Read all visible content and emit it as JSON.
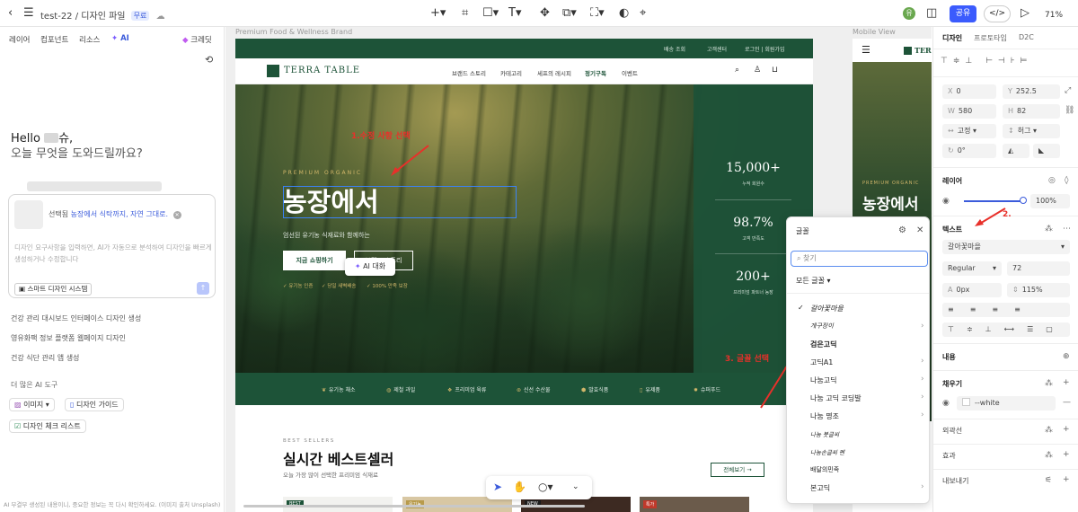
{
  "toolbar": {
    "breadcrumb_project": "test-22",
    "breadcrumb_sep": "/",
    "file_name": "디자인 파일",
    "badge": "무료",
    "share": "공유",
    "zoom": "71%",
    "avatar_initial": "유"
  },
  "left_panel": {
    "tabs": [
      "레이어",
      "컴포넌트",
      "리소스",
      "AI"
    ],
    "credit": "크레딧",
    "greeting_line1_a": "Hello",
    "greeting_line1_b": "슈,",
    "greeting_line2": "오늘 무엇을 도와드릴까요?",
    "selection_label": "선택됨",
    "selection_value": "농장에서 식탁까지, 자연 그대로.",
    "input_placeholder": "디자인 요구사항을 입력하면, AI가 자동으로 분석하여 디자인을 빠르게 생성하거나 수정합니다",
    "smart_design": "스마트 디자인 시스템",
    "suggestions": [
      "건강 관리 대시보드 인터페이스 디자인 생성",
      "영유화팩 정보 플랫폼 웹페이지 디자인",
      "건강 식단 관리 앱 생성"
    ],
    "more_tools": "더 많은 AI 도구",
    "tools": [
      "이미지",
      "디자인 가이드",
      "디자인 체크 리스트"
    ],
    "footer": "AI 부결부 생성된 내용이니, 중요한 정보는 꼭 다시 확인하세요. (이미지 출처 Unsplash)"
  },
  "canvas": {
    "frame_label_desktop": "Premium Food & Wellness Brand",
    "frame_label_mobile": "Mobile View",
    "util_links": [
      "배송 조회",
      "고객센터",
      "로그인 | 회원가입"
    ],
    "brand": "TERRA TABLE",
    "nav_links": [
      "브랜드 스토리",
      "카테고리",
      "세프의 레시피",
      "정기구독",
      "이벤트"
    ],
    "hero_eyebrow": "PREMIUM ORGANIC",
    "hero_title": "농장에서",
    "hero_subtitle": "엄선된 유기농 식재료와 함께하는",
    "btn_primary": "지금 쇼핑하기",
    "btn_outline": "브랜드 스토리",
    "ai_popup": "AI 대화",
    "hero_checks": [
      "✓ 유기농 인증",
      "✓ 당일 새벽배송",
      "✓ 100% 만족 보장"
    ],
    "stats": [
      {
        "num": "15,000+",
        "label": "누적 회원수"
      },
      {
        "num": "98.7%",
        "label": "고객 만족도"
      },
      {
        "num": "200+",
        "label": "프리미엄 파트너 농장"
      }
    ],
    "features": [
      "유기농 채소",
      "제철 과일",
      "프리미엄 육류",
      "신선 수산물",
      "발효식품",
      "유제품",
      "슈퍼푸드"
    ],
    "best_eyebrow": "BEST SELLERS",
    "best_title": "실시간 베스트셀러",
    "best_subtitle": "오늘 가장 많이 선택한 프리미엄 식재료",
    "view_all": "전체보기 →",
    "product_tags": [
      "BEST",
      "유기농",
      "NEW",
      "특가"
    ],
    "annotation_1": "1.수정 사항 선택",
    "annotation_2": "2.",
    "annotation_3": "3. 글꼴 선택",
    "mobile_title": "농장에서",
    "mobile_eyebrow": "PREMIUM ORGANIC",
    "mobile_brand": "TERR"
  },
  "font_panel": {
    "title": "글꼴",
    "search_placeholder": "찾기",
    "filter": "모든 글꼴",
    "items": [
      "갈아꽃마을",
      "개구장이",
      "검은고딕",
      "고딕A1",
      "나눔고딕",
      "나눔 고딕 코딩발",
      "나눔 명조",
      "나눔 붓글씨",
      "나눔손글씨 펜",
      "배달의민족",
      "본고딕"
    ]
  },
  "right_panel": {
    "tabs": [
      "디자인",
      "프로토타입",
      "D2C"
    ],
    "x_label": "X",
    "x_value": "0",
    "y_label": "Y",
    "y_value": "252.5",
    "w_label": "W",
    "w_value": "580",
    "h_label": "H",
    "h_value": "82",
    "width_mode": "고정",
    "height_mode": "허그",
    "rotation": "0°",
    "layer_section": "레이어",
    "opacity": "100%",
    "text_section": "텍스트",
    "font_family": "갈아꽃마을",
    "font_weight": "Regular",
    "font_size": "72",
    "letter_spacing": "0px",
    "line_height": "115%",
    "content_section": "내용",
    "fill_section": "채우기",
    "fill_value": "--white",
    "stroke_section": "외곽선",
    "effect_section": "효과",
    "export_section": "내보내기"
  }
}
